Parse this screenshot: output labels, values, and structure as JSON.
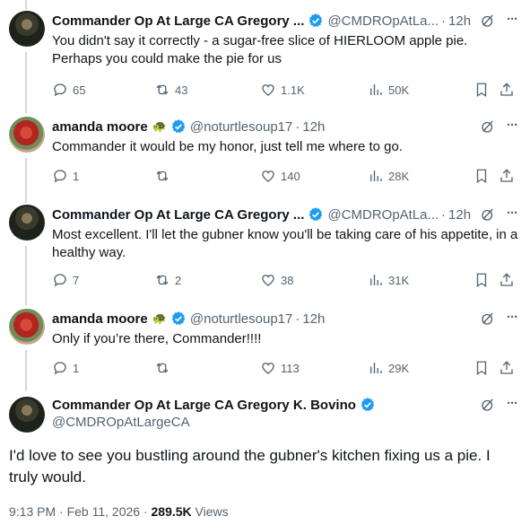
{
  "tweets": [
    {
      "name": "Commander Op At Large CA Gregory ...",
      "handle": "@CMDROpAtLa...",
      "time": "12h",
      "text": "You didn't say it correctly - a sugar-free slice of HIERLOOM apple pie. Perhaps you could make the pie for us",
      "replies": "65",
      "retweets": "43",
      "likes": "1.1K",
      "views": "50K"
    },
    {
      "name": "amanda moore",
      "badge": "🐢",
      "handle": "@noturtlesoup17",
      "time": "12h",
      "text": "Commander it would be my honor, just tell me where to go.",
      "replies": "1",
      "retweets": "",
      "likes": "140",
      "views": "28K"
    },
    {
      "name": "Commander Op At Large CA Gregory ...",
      "handle": "@CMDROpAtLa...",
      "time": "12h",
      "text": "Most excellent.   I'll let the gubner know you'll be taking care of his appetite, in a healthy way.",
      "replies": "7",
      "retweets": "2",
      "likes": "38",
      "views": "31K"
    },
    {
      "name": "amanda moore",
      "badge": "🐢",
      "handle": "@noturtlesoup17",
      "time": "12h",
      "text": "Only if you’re there, Commander!!!!",
      "replies": "1",
      "retweets": "",
      "likes": "113",
      "views": "29K"
    }
  ],
  "main_tweet": {
    "name": "Commander Op At Large CA Gregory K. Bovino",
    "handle": "@CMDROpAtLargeCA",
    "text": "I'd love to see you bustling around the gubner's kitchen fixing us a pie.  I truly would.",
    "timestamp": "9:13 PM · Feb 11, 2026 · ",
    "views_count": "289.5K",
    "views_label": " Views"
  },
  "ui": {
    "more_glyph": "···",
    "separator": "·"
  },
  "colors": {
    "verified": "#1d9bf0",
    "secondary_text": "#536471",
    "thread_line": "#cfd9de"
  }
}
